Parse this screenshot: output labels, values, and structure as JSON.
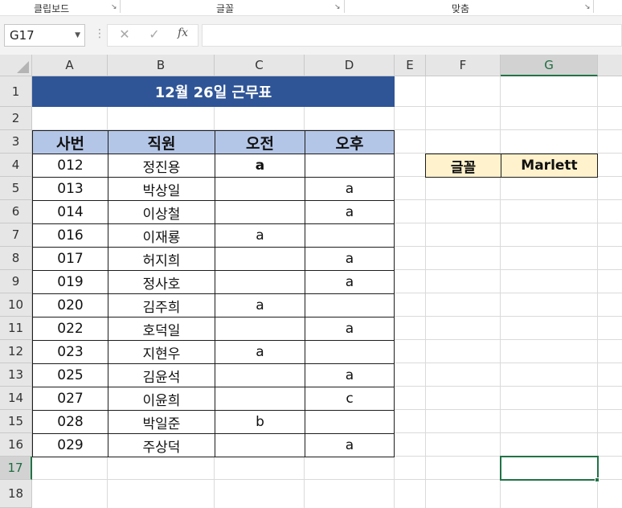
{
  "ribbon": {
    "groups": [
      {
        "label": "클립보드"
      },
      {
        "label": "글꼴"
      },
      {
        "label": "맞춤"
      }
    ],
    "launcher_icon": "dialog-launcher-icon"
  },
  "formula_bar": {
    "name_box": "G17",
    "formula": "",
    "cancel_icon": "✕",
    "enter_icon": "✓",
    "fx_label": "fx"
  },
  "columns": [
    "A",
    "B",
    "C",
    "D",
    "E",
    "F",
    "G"
  ],
  "selected_column": "G",
  "rows": [
    "1",
    "2",
    "3",
    "4",
    "5",
    "6",
    "7",
    "8",
    "9",
    "10",
    "11",
    "12",
    "13",
    "14",
    "15",
    "16",
    "17",
    "18"
  ],
  "selected_row": "17",
  "sheet": {
    "title": "12월 26일 근무표",
    "headers": [
      "사번",
      "직원",
      "오전",
      "오후"
    ],
    "records": [
      {
        "id": "012",
        "name": "정진용",
        "am": "a",
        "pm": ""
      },
      {
        "id": "013",
        "name": "박상일",
        "am": "",
        "pm": "a"
      },
      {
        "id": "014",
        "name": "이상철",
        "am": "",
        "pm": "a"
      },
      {
        "id": "016",
        "name": "이재룡",
        "am": "a",
        "pm": ""
      },
      {
        "id": "017",
        "name": "허지희",
        "am": "",
        "pm": "a"
      },
      {
        "id": "019",
        "name": "정사호",
        "am": "",
        "pm": "a"
      },
      {
        "id": "020",
        "name": "김주희",
        "am": "a",
        "pm": ""
      },
      {
        "id": "022",
        "name": "호덕일",
        "am": "",
        "pm": "a"
      },
      {
        "id": "023",
        "name": "지현우",
        "am": "a",
        "pm": ""
      },
      {
        "id": "025",
        "name": "김윤석",
        "am": "",
        "pm": "a"
      },
      {
        "id": "027",
        "name": "이윤희",
        "am": "",
        "pm": "c"
      },
      {
        "id": "028",
        "name": "박일준",
        "am": "b",
        "pm": ""
      },
      {
        "id": "029",
        "name": "주상덕",
        "am": "",
        "pm": "a"
      }
    ],
    "font_box": {
      "label": "글꼴",
      "value": "Marlett"
    }
  },
  "colors": {
    "title_fill": "#2f5597",
    "header_fill": "#b4c6e7",
    "gold_fill": "#fff2cc",
    "selection": "#217346"
  }
}
